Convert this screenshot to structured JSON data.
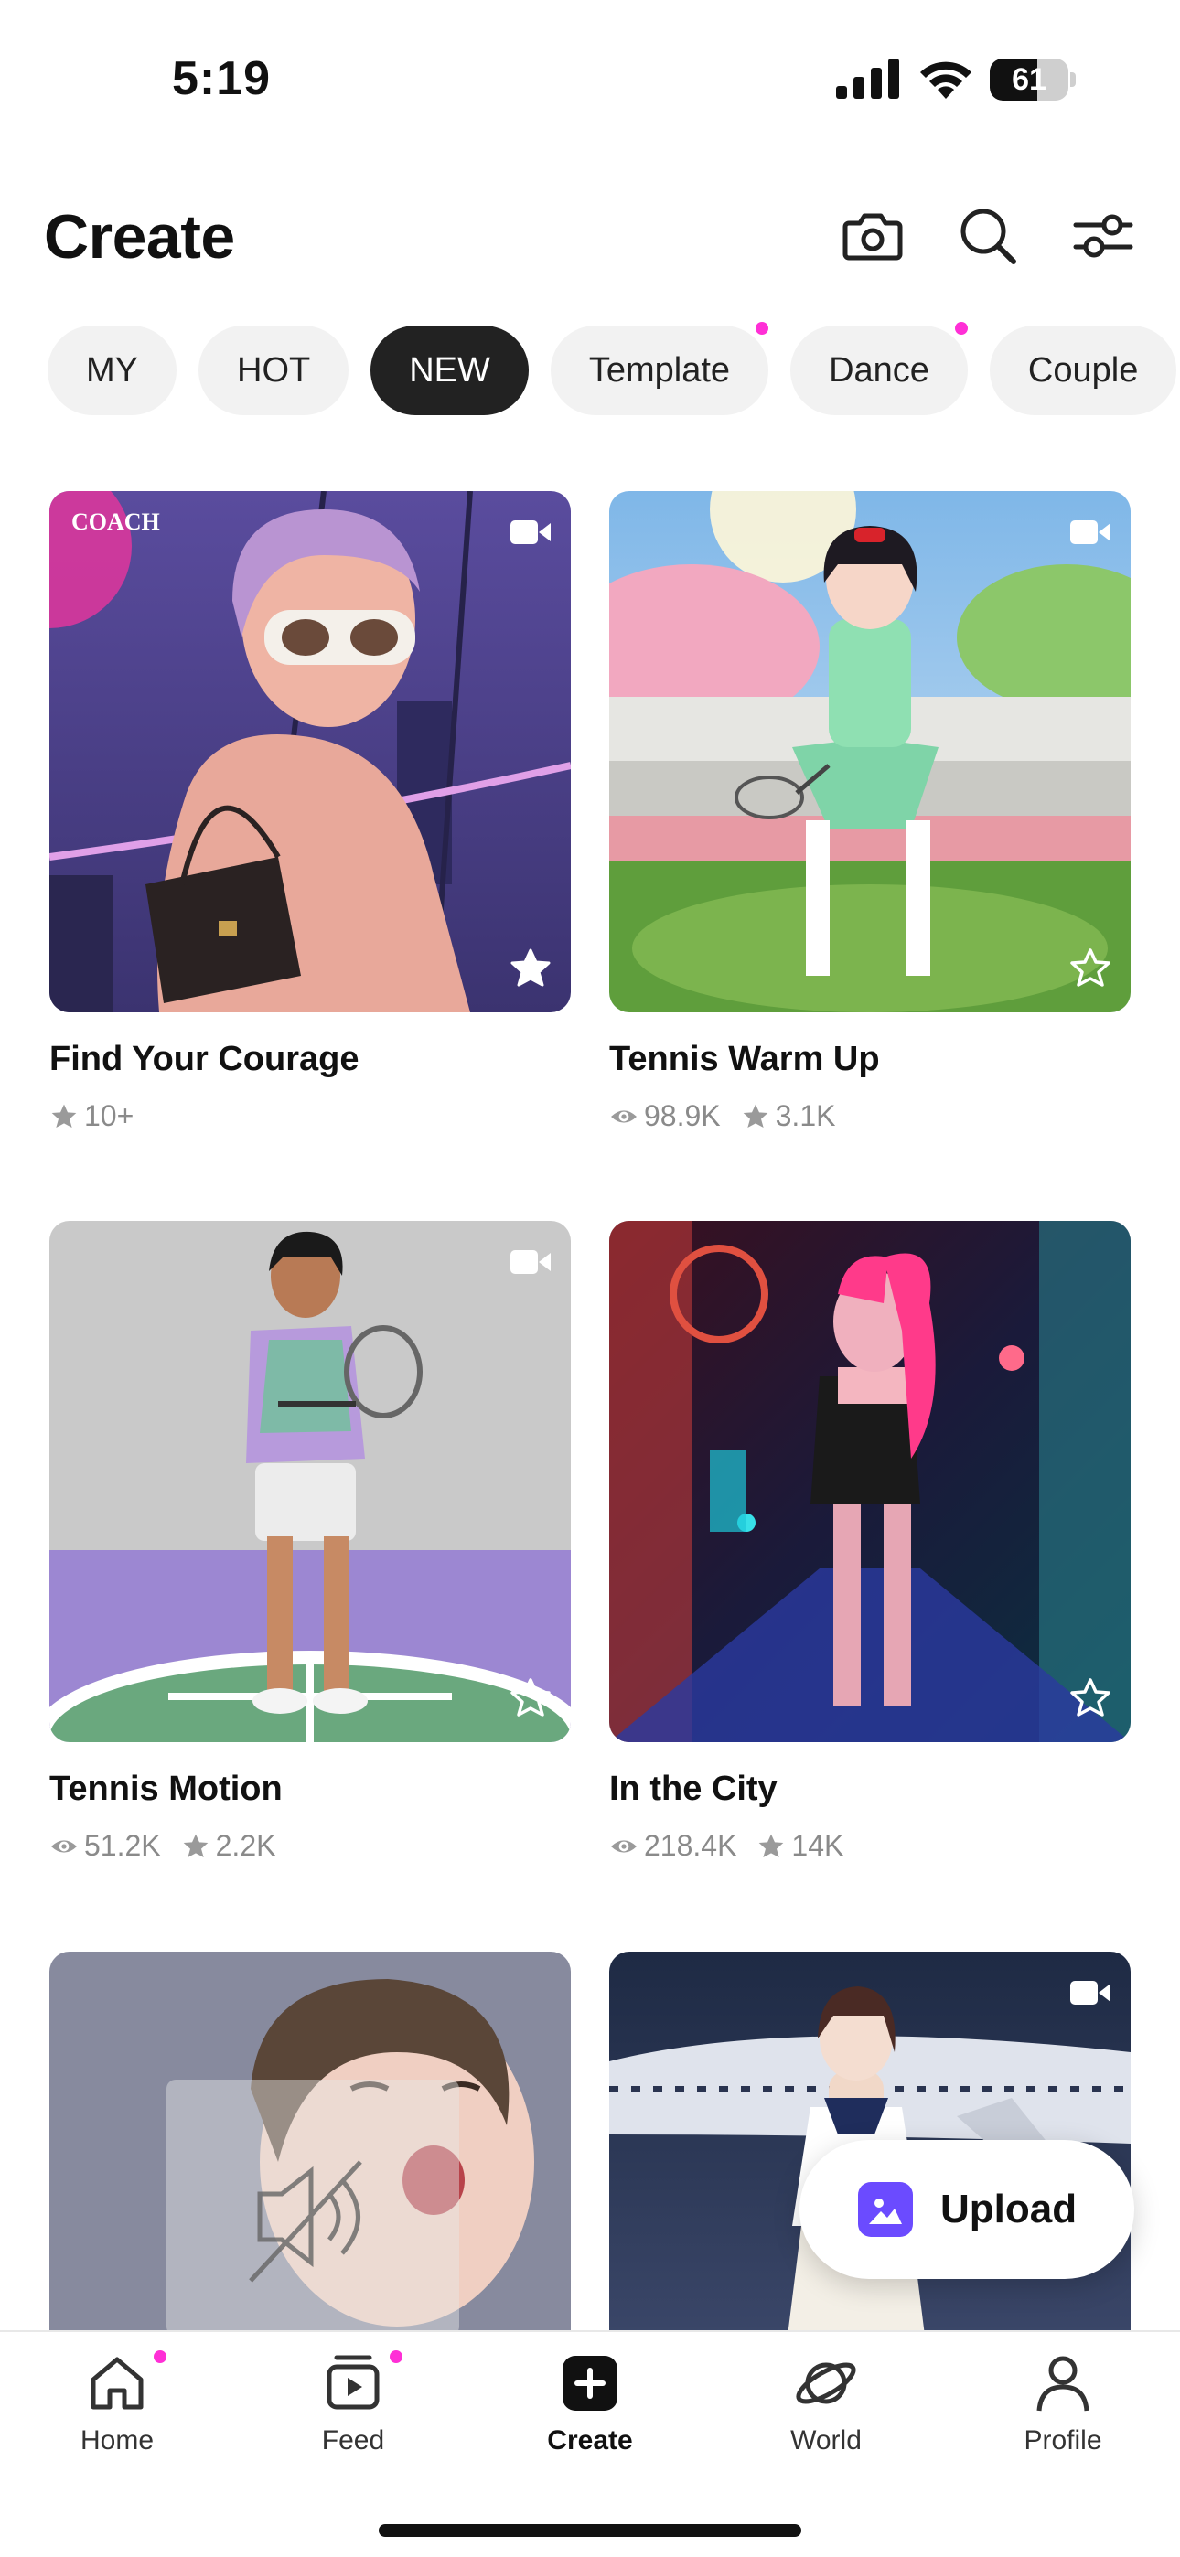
{
  "status": {
    "time": "5:19",
    "battery": "61",
    "battery_level": 0.61
  },
  "header": {
    "title": "Create"
  },
  "tabs": [
    {
      "label": "MY",
      "dot": false,
      "active": false
    },
    {
      "label": "HOT",
      "dot": false,
      "active": false
    },
    {
      "label": "NEW",
      "dot": false,
      "active": true
    },
    {
      "label": "Template",
      "dot": true,
      "active": false
    },
    {
      "label": "Dance",
      "dot": true,
      "active": false
    },
    {
      "label": "Couple",
      "dot": false,
      "active": false
    }
  ],
  "cards": [
    {
      "title": "Find Your Courage",
      "views": "",
      "stars": "10+",
      "brand": "COACH",
      "video": true,
      "favorited": true
    },
    {
      "title": "Tennis Warm Up",
      "views": "98.9K",
      "stars": "3.1K",
      "video": true,
      "favorited": false
    },
    {
      "title": "Tennis Motion",
      "views": "51.2K",
      "stars": "2.2K",
      "video": true,
      "favorited": false
    },
    {
      "title": "In the City",
      "views": "218.4K",
      "stars": "14K",
      "video": false,
      "favorited": false
    },
    {
      "title": "",
      "views": "",
      "stars": "",
      "video": false,
      "favorited": false
    },
    {
      "title": "",
      "views": "",
      "stars": "",
      "video": true,
      "favorited": false
    }
  ],
  "upload": {
    "label": "Upload"
  },
  "nav": {
    "home": "Home",
    "feed": "Feed",
    "create": "Create",
    "world": "World",
    "profile": "Profile"
  },
  "colors": {
    "accent": "#ff2fd6",
    "upload_icon": "#6b4bff",
    "active_tab": "#222222"
  }
}
